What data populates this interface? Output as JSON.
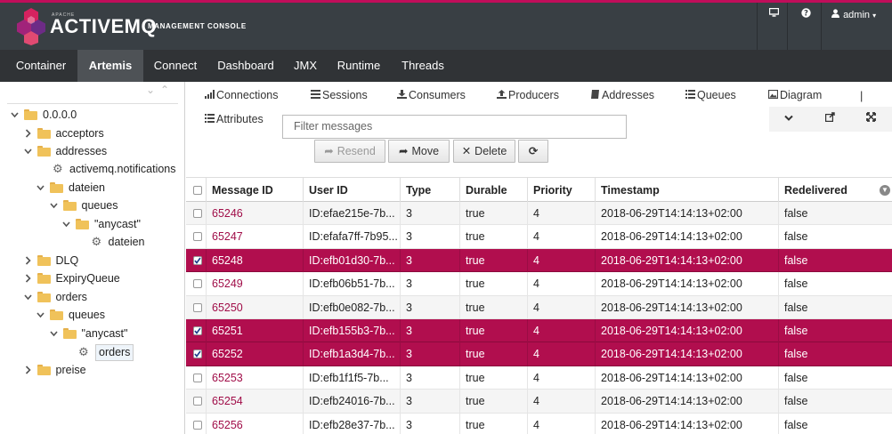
{
  "header": {
    "brand_small": "APACHE",
    "brand": "ACTIVEMQ",
    "brand_sub": "MANAGEMENT CONSOLE",
    "user": "admin",
    "icons": [
      "monitor-icon",
      "help-icon",
      "user-icon"
    ]
  },
  "nav": {
    "items": [
      "Container",
      "Artemis",
      "Connect",
      "Dashboard",
      "JMX",
      "Runtime",
      "Threads"
    ],
    "active": "Artemis"
  },
  "tree": {
    "nodes": [
      {
        "label": "0.0.0.0",
        "type": "folder",
        "open": true
      },
      {
        "label": "acceptors",
        "type": "folder",
        "open": false
      },
      {
        "label": "addresses",
        "type": "folder",
        "open": true
      },
      {
        "label": "activemq.notifications",
        "type": "gear"
      },
      {
        "label": "dateien",
        "type": "folder",
        "open": true
      },
      {
        "label": "queues",
        "type": "folder",
        "open": true
      },
      {
        "label": "\"anycast\"",
        "type": "folder",
        "open": true
      },
      {
        "label": "dateien",
        "type": "gear"
      },
      {
        "label": "DLQ",
        "type": "folder",
        "open": false
      },
      {
        "label": "ExpiryQueue",
        "type": "folder",
        "open": false
      },
      {
        "label": "orders",
        "type": "folder",
        "open": true
      },
      {
        "label": "queues",
        "type": "folder",
        "open": true
      },
      {
        "label": "\"anycast\"",
        "type": "folder",
        "open": true
      },
      {
        "label": "orders",
        "type": "gear",
        "selected": true
      },
      {
        "label": "preise",
        "type": "folder",
        "open": false
      }
    ]
  },
  "tabs": {
    "connections": "Connections",
    "sessions": "Sessions",
    "consumers": "Consumers",
    "producers": "Producers",
    "addresses": "Addresses",
    "queues": "Queues",
    "diagram": "Diagram",
    "attributes": "Attributes",
    "separator": "|"
  },
  "filter": {
    "placeholder": "Filter messages"
  },
  "buttons": {
    "resend": "Resend",
    "move": "Move",
    "delete": "Delete"
  },
  "table": {
    "columns": [
      "Message ID",
      "User ID",
      "Type",
      "Durable",
      "Priority",
      "Timestamp",
      "Redelivered"
    ],
    "rows": [
      {
        "id": "65246",
        "user": "ID:efae215e-7b...",
        "type": "3",
        "durable": "true",
        "priority": "4",
        "ts": "2018-06-29T14:14:13+02:00",
        "redelivered": "false",
        "selected": false
      },
      {
        "id": "65247",
        "user": "ID:efafa7ff-7b95...",
        "type": "3",
        "durable": "true",
        "priority": "4",
        "ts": "2018-06-29T14:14:13+02:00",
        "redelivered": "false",
        "selected": false
      },
      {
        "id": "65248",
        "user": "ID:efb01d30-7b...",
        "type": "3",
        "durable": "true",
        "priority": "4",
        "ts": "2018-06-29T14:14:13+02:00",
        "redelivered": "false",
        "selected": true
      },
      {
        "id": "65249",
        "user": "ID:efb06b51-7b...",
        "type": "3",
        "durable": "true",
        "priority": "4",
        "ts": "2018-06-29T14:14:13+02:00",
        "redelivered": "false",
        "selected": false
      },
      {
        "id": "65250",
        "user": "ID:efb0e082-7b...",
        "type": "3",
        "durable": "true",
        "priority": "4",
        "ts": "2018-06-29T14:14:13+02:00",
        "redelivered": "false",
        "selected": false
      },
      {
        "id": "65251",
        "user": "ID:efb155b3-7b...",
        "type": "3",
        "durable": "true",
        "priority": "4",
        "ts": "2018-06-29T14:14:13+02:00",
        "redelivered": "false",
        "selected": true
      },
      {
        "id": "65252",
        "user": "ID:efb1a3d4-7b...",
        "type": "3",
        "durable": "true",
        "priority": "4",
        "ts": "2018-06-29T14:14:13+02:00",
        "redelivered": "false",
        "selected": true
      },
      {
        "id": "65253",
        "user": "ID:efb1f1f5-7b...",
        "type": "3",
        "durable": "true",
        "priority": "4",
        "ts": "2018-06-29T14:14:13+02:00",
        "redelivered": "false",
        "selected": false
      },
      {
        "id": "65254",
        "user": "ID:efb24016-7b...",
        "type": "3",
        "durable": "true",
        "priority": "4",
        "ts": "2018-06-29T14:14:13+02:00",
        "redelivered": "false",
        "selected": false
      },
      {
        "id": "65256",
        "user": "ID:efb28e37-7b...",
        "type": "3",
        "durable": "true",
        "priority": "4",
        "ts": "2018-06-29T14:14:13+02:00",
        "redelivered": "false",
        "selected": false
      }
    ]
  },
  "colors": {
    "accent": "#c00d5a",
    "selected_row": "#b10e4e",
    "header_bg": "#393f44",
    "nav_bg": "#303336"
  }
}
